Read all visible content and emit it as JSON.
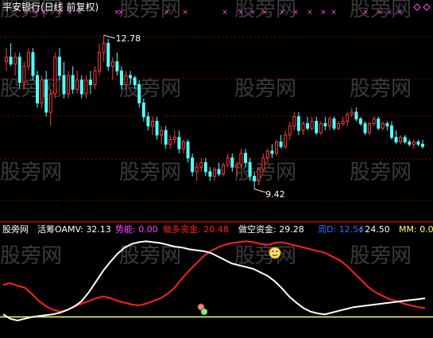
{
  "header": {
    "title": "平安银行(日线 前复权)"
  },
  "watermark": "股旁网",
  "colors": {
    "up": "#ff3b3b",
    "down": "#54ffff",
    "grid": "#8b0000",
    "ma_white": "#ffffff",
    "ma_red": "#ff2020",
    "level_yellow": "#ffff66",
    "marker": "#ff44ff"
  },
  "indicator": {
    "brand": "股旁网",
    "items": [
      {
        "label": "活筹OAMV: ",
        "value": "32.13",
        "color": "#ffffff"
      },
      {
        "label": "势能: ",
        "value": "0.00",
        "color": "#ff44ff"
      },
      {
        "label": "做多资金: ",
        "value": "20.48",
        "color": "#ff2020"
      },
      {
        "label": "做空资金: ",
        "value": "29.28",
        "color": "#ffffff"
      },
      {
        "label": "周D: ",
        "value": "12.54",
        "color": "#3d6bff"
      },
      {
        "label": ": ",
        "value": "24.50",
        "color": "#ffffff"
      },
      {
        "label": "MM: ",
        "value": "0.00",
        "color": "#ffff66"
      }
    ]
  },
  "chart_data": [
    {
      "type": "candlestick",
      "annotations": [
        {
          "text": "12.78",
          "kind": "high"
        },
        {
          "text": "9.42",
          "kind": "low"
        }
      ],
      "ylim": [
        9.0,
        13.2
      ],
      "grid": true,
      "candles": [
        [
          12.2,
          12.5,
          12.0,
          12.3
        ],
        [
          12.3,
          12.6,
          12.1,
          12.15
        ],
        [
          12.15,
          12.4,
          11.9,
          12.3
        ],
        [
          12.3,
          12.4,
          11.6,
          11.75
        ],
        [
          11.75,
          12.2,
          11.6,
          12.1
        ],
        [
          12.1,
          12.5,
          12.0,
          12.4
        ],
        [
          12.4,
          12.5,
          11.8,
          11.9
        ],
        [
          11.9,
          12.0,
          11.2,
          11.3
        ],
        [
          11.3,
          11.9,
          11.2,
          11.8
        ],
        [
          11.8,
          12.0,
          11.0,
          11.1
        ],
        [
          11.1,
          11.6,
          10.8,
          11.5
        ],
        [
          11.5,
          12.4,
          11.4,
          12.3
        ],
        [
          12.3,
          12.5,
          11.8,
          11.9
        ],
        [
          11.9,
          12.2,
          11.4,
          11.5
        ],
        [
          11.5,
          12.0,
          11.4,
          11.9
        ],
        [
          11.9,
          12.1,
          11.5,
          11.6
        ],
        [
          11.6,
          12.0,
          11.5,
          11.8
        ],
        [
          11.8,
          11.9,
          11.4,
          11.5
        ],
        [
          11.5,
          11.9,
          11.4,
          11.8
        ],
        [
          11.8,
          12.0,
          11.5,
          11.7
        ],
        [
          11.7,
          12.1,
          11.6,
          12.0
        ],
        [
          12.0,
          12.6,
          11.9,
          12.4
        ],
        [
          12.4,
          12.78,
          12.2,
          12.6
        ],
        [
          12.6,
          12.7,
          12.0,
          12.1
        ],
        [
          12.1,
          12.3,
          11.8,
          12.2
        ],
        [
          12.2,
          12.4,
          11.9,
          12.0
        ],
        [
          12.0,
          12.1,
          11.6,
          11.7
        ],
        [
          11.7,
          12.0,
          11.6,
          11.9
        ],
        [
          11.9,
          12.0,
          11.7,
          11.85
        ],
        [
          11.85,
          11.9,
          11.6,
          11.7
        ],
        [
          11.7,
          11.8,
          11.2,
          11.3
        ],
        [
          11.3,
          11.4,
          10.9,
          11.0
        ],
        [
          11.0,
          11.1,
          10.7,
          10.8
        ],
        [
          10.8,
          11.0,
          10.6,
          10.9
        ],
        [
          10.9,
          11.0,
          10.5,
          10.6
        ],
        [
          10.6,
          10.8,
          10.4,
          10.7
        ],
        [
          10.7,
          10.8,
          10.3,
          10.4
        ],
        [
          10.4,
          10.6,
          10.3,
          10.5
        ],
        [
          10.5,
          10.7,
          10.4,
          10.55
        ],
        [
          10.55,
          10.7,
          10.2,
          10.3
        ],
        [
          10.3,
          10.5,
          10.2,
          10.45
        ],
        [
          10.45,
          10.5,
          10.0,
          10.1
        ],
        [
          10.1,
          10.2,
          9.7,
          9.8
        ],
        [
          9.8,
          10.0,
          9.6,
          9.9
        ],
        [
          9.9,
          10.1,
          9.8,
          10.0
        ],
        [
          10.0,
          10.1,
          9.7,
          9.8
        ],
        [
          9.8,
          9.9,
          9.6,
          9.7
        ],
        [
          9.7,
          9.9,
          9.6,
          9.85
        ],
        [
          9.85,
          10.0,
          9.7,
          9.75
        ],
        [
          9.75,
          10.0,
          9.7,
          9.95
        ],
        [
          9.95,
          10.2,
          9.9,
          10.1
        ],
        [
          10.1,
          10.2,
          9.8,
          9.9
        ],
        [
          9.9,
          10.0,
          9.7,
          9.95
        ],
        [
          9.95,
          10.3,
          9.9,
          10.2
        ],
        [
          10.2,
          10.3,
          9.9,
          10.0
        ],
        [
          10.0,
          10.1,
          9.6,
          9.7
        ],
        [
          9.7,
          9.8,
          9.42,
          9.6
        ],
        [
          9.6,
          9.9,
          9.5,
          9.85
        ],
        [
          9.85,
          10.2,
          9.8,
          10.1
        ],
        [
          10.1,
          10.3,
          10.0,
          10.25
        ],
        [
          10.25,
          10.4,
          10.1,
          10.2
        ],
        [
          10.2,
          10.5,
          10.15,
          10.45
        ],
        [
          10.45,
          10.6,
          10.3,
          10.35
        ],
        [
          10.35,
          10.7,
          10.3,
          10.6
        ],
        [
          10.6,
          10.9,
          10.5,
          10.8
        ],
        [
          10.8,
          11.1,
          10.7,
          11.0
        ],
        [
          11.0,
          11.1,
          10.6,
          10.7
        ],
        [
          10.7,
          10.9,
          10.6,
          10.85
        ],
        [
          10.85,
          11.0,
          10.7,
          10.75
        ],
        [
          10.75,
          11.0,
          10.7,
          10.9
        ],
        [
          10.9,
          11.0,
          10.6,
          10.65
        ],
        [
          10.65,
          10.9,
          10.6,
          10.85
        ],
        [
          10.85,
          11.0,
          10.7,
          10.8
        ],
        [
          10.8,
          11.0,
          10.7,
          10.95
        ],
        [
          10.95,
          11.0,
          10.7,
          10.75
        ],
        [
          10.75,
          10.9,
          10.7,
          10.85
        ],
        [
          10.85,
          11.0,
          10.8,
          10.9
        ],
        [
          10.9,
          11.1,
          10.8,
          11.05
        ],
        [
          11.05,
          11.2,
          11.0,
          11.1
        ],
        [
          11.1,
          11.2,
          10.9,
          10.95
        ],
        [
          10.95,
          11.0,
          10.8,
          10.85
        ],
        [
          10.85,
          10.9,
          10.6,
          10.65
        ],
        [
          10.65,
          10.9,
          10.6,
          10.85
        ],
        [
          10.85,
          11.0,
          10.8,
          10.95
        ],
        [
          10.95,
          11.0,
          10.7,
          10.75
        ],
        [
          10.75,
          10.9,
          10.7,
          10.85
        ],
        [
          10.85,
          10.9,
          10.7,
          10.8
        ],
        [
          10.8,
          10.9,
          10.5,
          10.55
        ],
        [
          10.55,
          10.7,
          10.4,
          10.45
        ],
        [
          10.45,
          10.6,
          10.4,
          10.55
        ],
        [
          10.55,
          10.6,
          10.4,
          10.45
        ],
        [
          10.45,
          10.5,
          10.35,
          10.4
        ],
        [
          10.4,
          10.5,
          10.3,
          10.45
        ],
        [
          10.45,
          10.5,
          10.35,
          10.4
        ],
        [
          10.4,
          10.5,
          10.3,
          10.35
        ]
      ]
    },
    {
      "type": "line",
      "ylim": [
        0,
        100
      ],
      "series": [
        {
          "values": [
            48,
            50,
            47,
            45,
            38,
            30,
            24,
            20,
            18,
            20,
            24,
            27,
            30,
            33,
            35,
            33,
            30,
            28,
            26,
            25,
            27,
            30,
            33,
            38,
            45,
            55,
            64,
            72,
            80,
            86,
            90,
            93,
            95,
            96,
            97,
            96,
            94,
            93,
            95,
            96,
            94,
            92,
            90,
            88,
            86,
            84,
            80,
            76,
            70,
            62,
            54,
            46,
            40,
            36,
            32,
            30,
            27,
            25,
            23,
            22
          ],
          "color": "#ff2020"
        },
        {
          "values": [
            15,
            10,
            8,
            10,
            12,
            13,
            14,
            15,
            17,
            20,
            24,
            30,
            40,
            52,
            64,
            74,
            83,
            90,
            94,
            96,
            97,
            96,
            95,
            93,
            91,
            90,
            88,
            87,
            86,
            84,
            80,
            76,
            72,
            70,
            68,
            66,
            62,
            58,
            52,
            44,
            35,
            28,
            22,
            18,
            16,
            15,
            17,
            19,
            21,
            23,
            24,
            25,
            26,
            27,
            28,
            29,
            30,
            31,
            32,
            33
          ],
          "color": "#ffffff"
        }
      ],
      "reference_line": 12,
      "markers": [
        "smiley",
        "dot",
        "dot"
      ]
    }
  ]
}
